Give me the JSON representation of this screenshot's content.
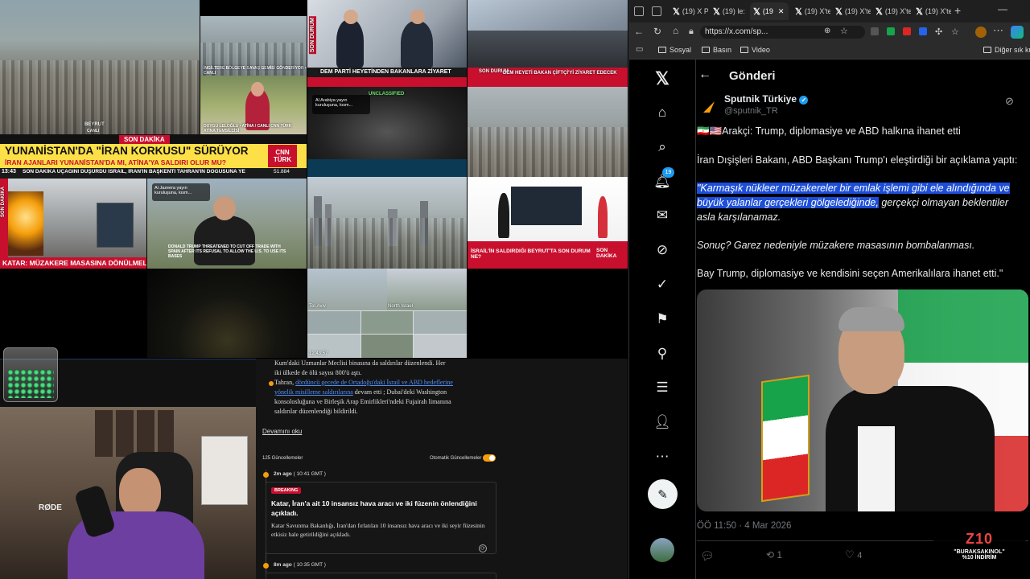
{
  "tv": {
    "beyrut_label": "BEYRUT",
    "beyrut_sub": "CANLI",
    "ingiltere_caption": "İNGİLTERE BÖLGEYE SAVAŞ GEMİSİ GÖNDERİYOR • CANLI",
    "duygu_caption": "DUYGU LELOĞLU • ATİNA / CANLI CNN TÜRK ATİNA TEMSİLCİSİ",
    "dem_caption": "DEM PARTİ HEYETİNDEN BAKANLARA ZİYARET",
    "son_durum": "SON DURUM",
    "dem2_caption": "DEM HEYETİ BAKAN ÇİFTÇİ'Yİ ZİYARET EDECEK",
    "son_dakika": "SON DAKİKA",
    "headline": "YUNANİSTAN'DA \"İRAN KORKUSU\" SÜRÜYOR",
    "subheadline": "İRAN AJANLARI YUNANİSTAN'DA MI, ATİNA'YA SALDIRI OLUR MU?",
    "ticker_time": "13:43",
    "ticker_text": "SON DAKİKA   UÇAĞINI DÜŞÜRDÜ   İSRAİL, İRAN'IN BAŞKENTİ TAHRAN'IN DOĞUSUNA YE",
    "ticker_index": "51.884",
    "cnn_logo": "CNN TÜRK",
    "unclassified": "UNCLASSIFIED",
    "alarabiya": "Al Arabiya yayın kuruluşuna, kısm...",
    "aljazeera": "Al Jazeera yayın kuruluşuna, kısm...",
    "katar_caption": "KATAR: MÜZAKERE MASASINA DÖNÜLMELİ",
    "trump_caption": "DONALD TRUMP THREATENED TO CUT OFF TRADE WITH SPAIN AFTER ITS REFUSAL TO ALLOW THE U.S. TO USE ITS BASES",
    "israil_caption": "İSRAİL'İN SALDIRDIĞI BEYRUT'TA SON DURUM NE?",
    "son_dakika_vert": "SON DAKİKA",
    "telaviv": "Tel-Aviv",
    "north_israel": "North Israel",
    "cam_time": "12:43:57"
  },
  "stream": {
    "para1": "Kum'daki Uzmanlar Meclisi binasına da saldırılar düzenlendi. Her iki ülkede de ölü sayısı 800'ü aştı.",
    "bullet_pre": "Tahran, ",
    "bullet_link": "dördüncü gecede de Ortadoğu'daki İsrail ve ABD hedeflerine yönelik misilleme saldırılarına",
    "bullet_post": " devam etti ; Dubai'deki Washington konsolosluğuna ve Birleşik Arap Emirlikleri'ndeki Fujairah limanına saldırılar düzenlendiği bildirildi.",
    "read_more": "Devamını oku",
    "updates_count": "125 Güncellemeler",
    "auto_updates": "Otomatik Güncellemeler",
    "card1_time": "2m ago",
    "card1_gmt": "( 10:41 GMT )",
    "card1_badge": "BREAKING",
    "card1_title": "Katar, İran'a ait 10 insansız hava aracı ve iki füzenin önlendiğini açıkladı.",
    "card1_body": "Katar Savunma Bakanlığı, İran'dan fırlatılan 10 insansız hava aracı ve iki seyir füzesinin etkisiz hale getirildiğini açıkladı.",
    "card2_time": "8m ago",
    "card2_gmt": "( 10:35 GMT )",
    "mic_brand": "RØDE"
  },
  "browser": {
    "tabs": [
      "(19) X P",
      "(19) le:",
      "(19",
      "(19) X'te",
      "(19) X'te",
      "(19) X'te",
      "(19) X'te"
    ],
    "url": "https://x.com/sp...",
    "favorites": [
      "Sosyal",
      "Basın",
      "Video"
    ],
    "other_favorites": "Diğer sık kul"
  },
  "x": {
    "notif_count": "19",
    "header": "Gönderi",
    "display_name": "Sputnik Türkiye",
    "handle": "@sputnik_TR",
    "line1": "🇮🇷🇺🇸Arakçi: Trump, diplomasiye ve ABD halkına ihanet etti",
    "line2": "İran Dışişleri Bakanı, ABD Başkanı Trump'ı eleştirdiği bir açıklama yaptı:",
    "quote_hl": "\"Karmaşık nükleer müzakereler bir emlak işlemi gibi ele alındığında ve büyük yalanlar gerçekleri gölgelediğinde,",
    "quote_rest": " gerçekçi olmayan beklentiler asla karşılanamaz.",
    "line4": "Sonuç? Garez nedeniyle müzakere masasının bombalanması.",
    "line5": "Bay Trump, diplomasiye ve kendisini seçen Amerikalılara ihanet etti.\"",
    "timestamp": "ÖÖ 11:50 · 4 Mar 2026",
    "retweets": "1",
    "likes": "4"
  },
  "overlay": {
    "logo": "Z10",
    "promo": "\"BURAKSAKINOL\"",
    "discount": "%10 İNDİRİM"
  },
  "colors": {
    "x_blue": "#1d9bf0",
    "highlight": "#1d4ed8",
    "cnn_red": "#c8102e",
    "orange": "#f59e0b"
  }
}
